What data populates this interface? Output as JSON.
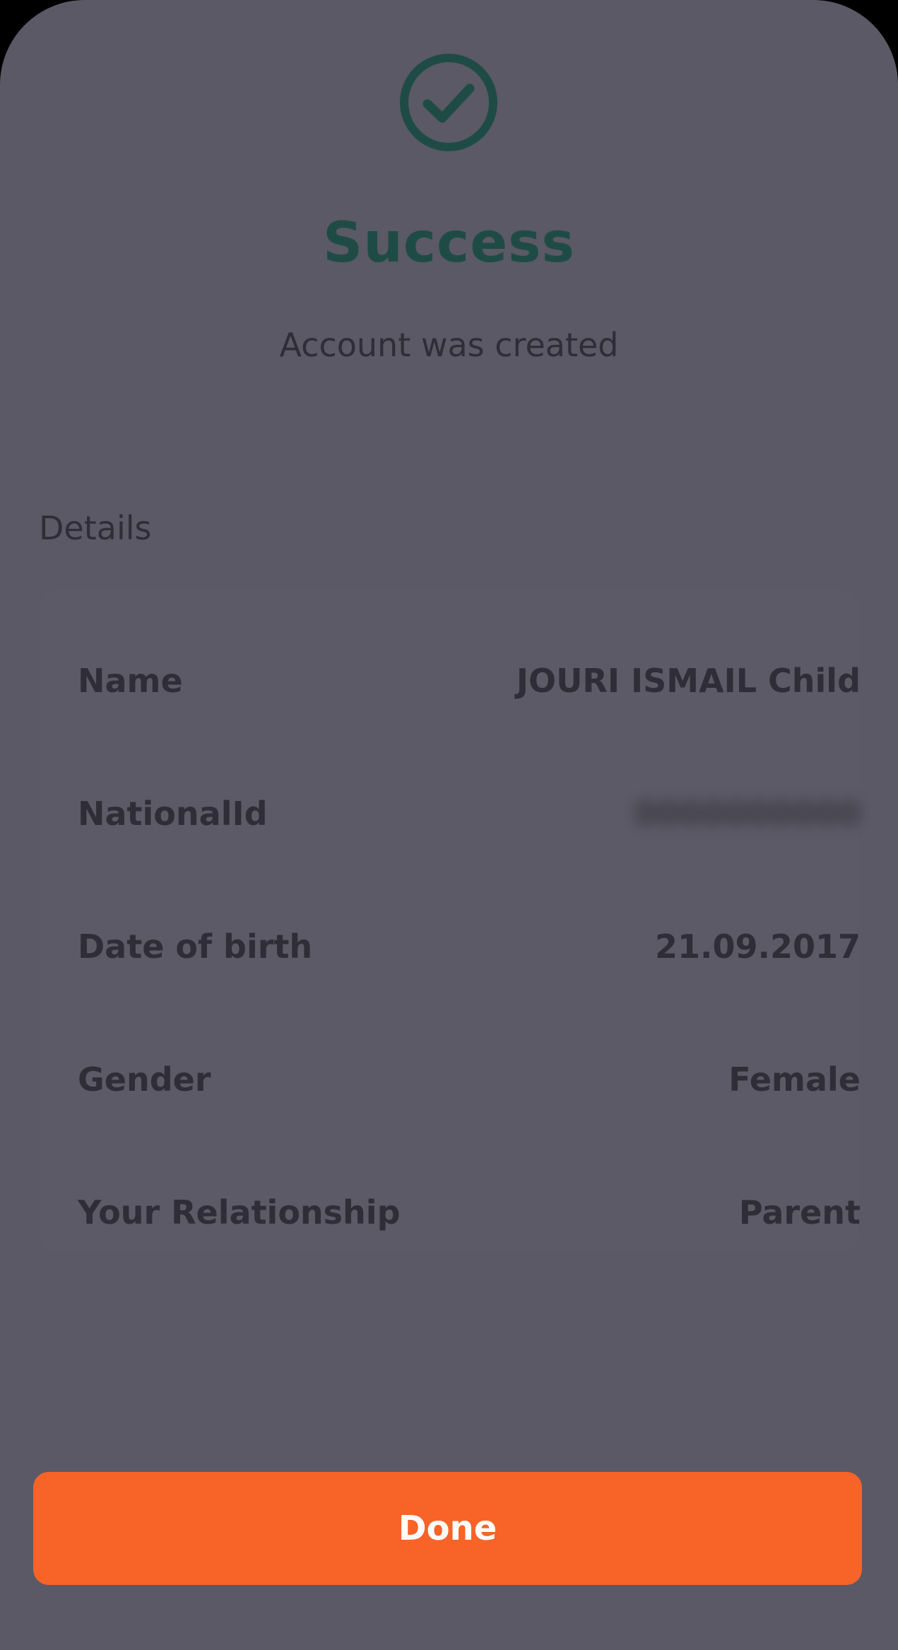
{
  "colors": {
    "accent_success": "#1f4b46",
    "primary_button": "#f86428",
    "button_text": "#ffffff",
    "text_muted": "#2e2d38"
  },
  "header": {
    "icon": "check-circle-icon",
    "title": "Success",
    "subtitle": "Account was created"
  },
  "details": {
    "section_label": "Details",
    "rows": [
      {
        "label": "Name",
        "value": "JOURI ISMAIL Child"
      },
      {
        "label": "NationalId",
        "value": "0000000000"
      },
      {
        "label": "Date of birth",
        "value": "21.09.2017"
      },
      {
        "label": "Gender",
        "value": "Female"
      },
      {
        "label": "Your Relationship",
        "value": "Parent"
      }
    ]
  },
  "actions": {
    "done_label": "Done"
  }
}
